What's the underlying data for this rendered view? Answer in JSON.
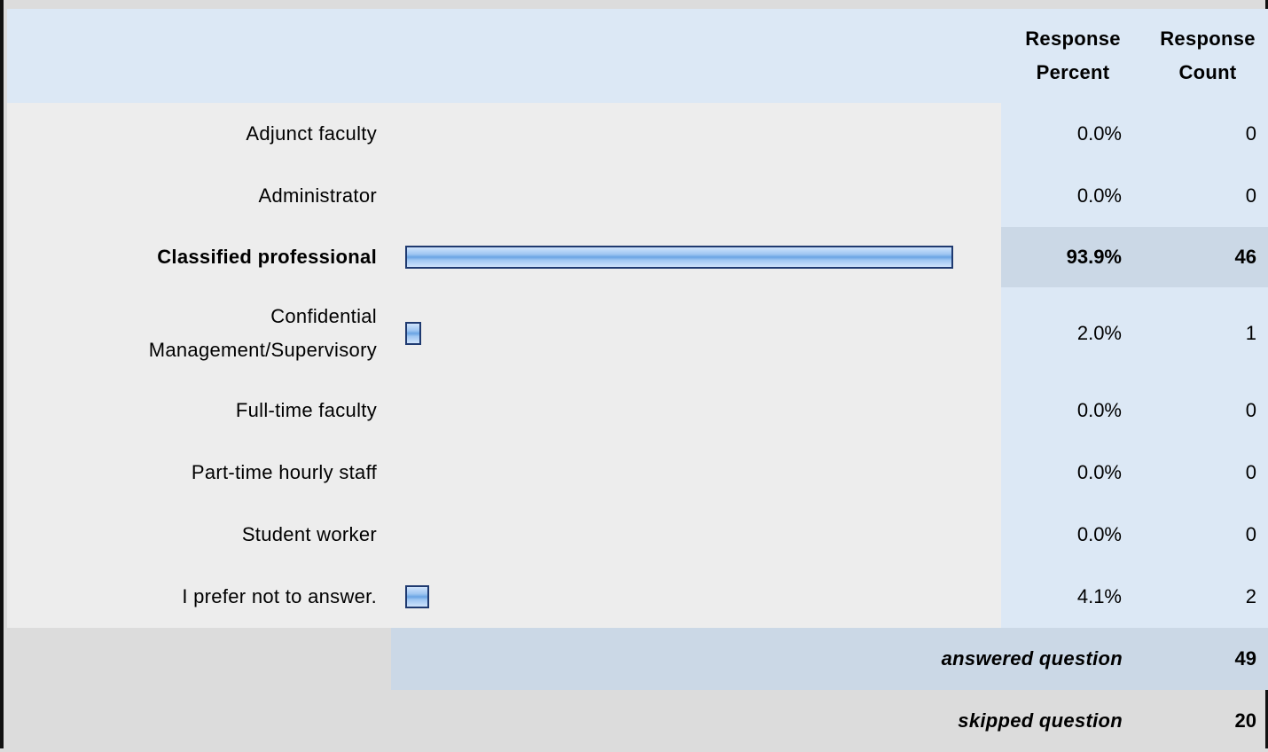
{
  "header": {
    "percent_label": "Response Percent",
    "count_label": "Response Count"
  },
  "chart_data": {
    "type": "bar",
    "categories": [
      "Adjunct faculty",
      "Administrator",
      "Classified professional",
      "Confidential Management/Supervisory",
      "Full-time faculty",
      "Part-time hourly staff",
      "Student worker",
      "I prefer not to answer."
    ],
    "values": [
      0.0,
      0.0,
      93.9,
      2.0,
      0.0,
      0.0,
      0.0,
      4.1
    ],
    "percent_labels": [
      "0.0%",
      "0.0%",
      "93.9%",
      "2.0%",
      "0.0%",
      "0.0%",
      "0.0%",
      "4.1%"
    ],
    "counts": [
      "0",
      "0",
      "46",
      "1",
      "0",
      "0",
      "0",
      "2"
    ],
    "highlighted": [
      false,
      false,
      true,
      false,
      false,
      false,
      false,
      false
    ],
    "xlim": [
      0,
      100
    ]
  },
  "summary": {
    "answered_label": "answered question",
    "answered_value": "49",
    "skipped_label": "skipped question",
    "skipped_value": "20"
  },
  "colors": {
    "bar_border": "#1f3a70",
    "bar_fill": "#8fbcee",
    "header_bg": "#dce8f5",
    "label_bg": "#ededed",
    "highlight_bg": "#cbd8e6"
  }
}
